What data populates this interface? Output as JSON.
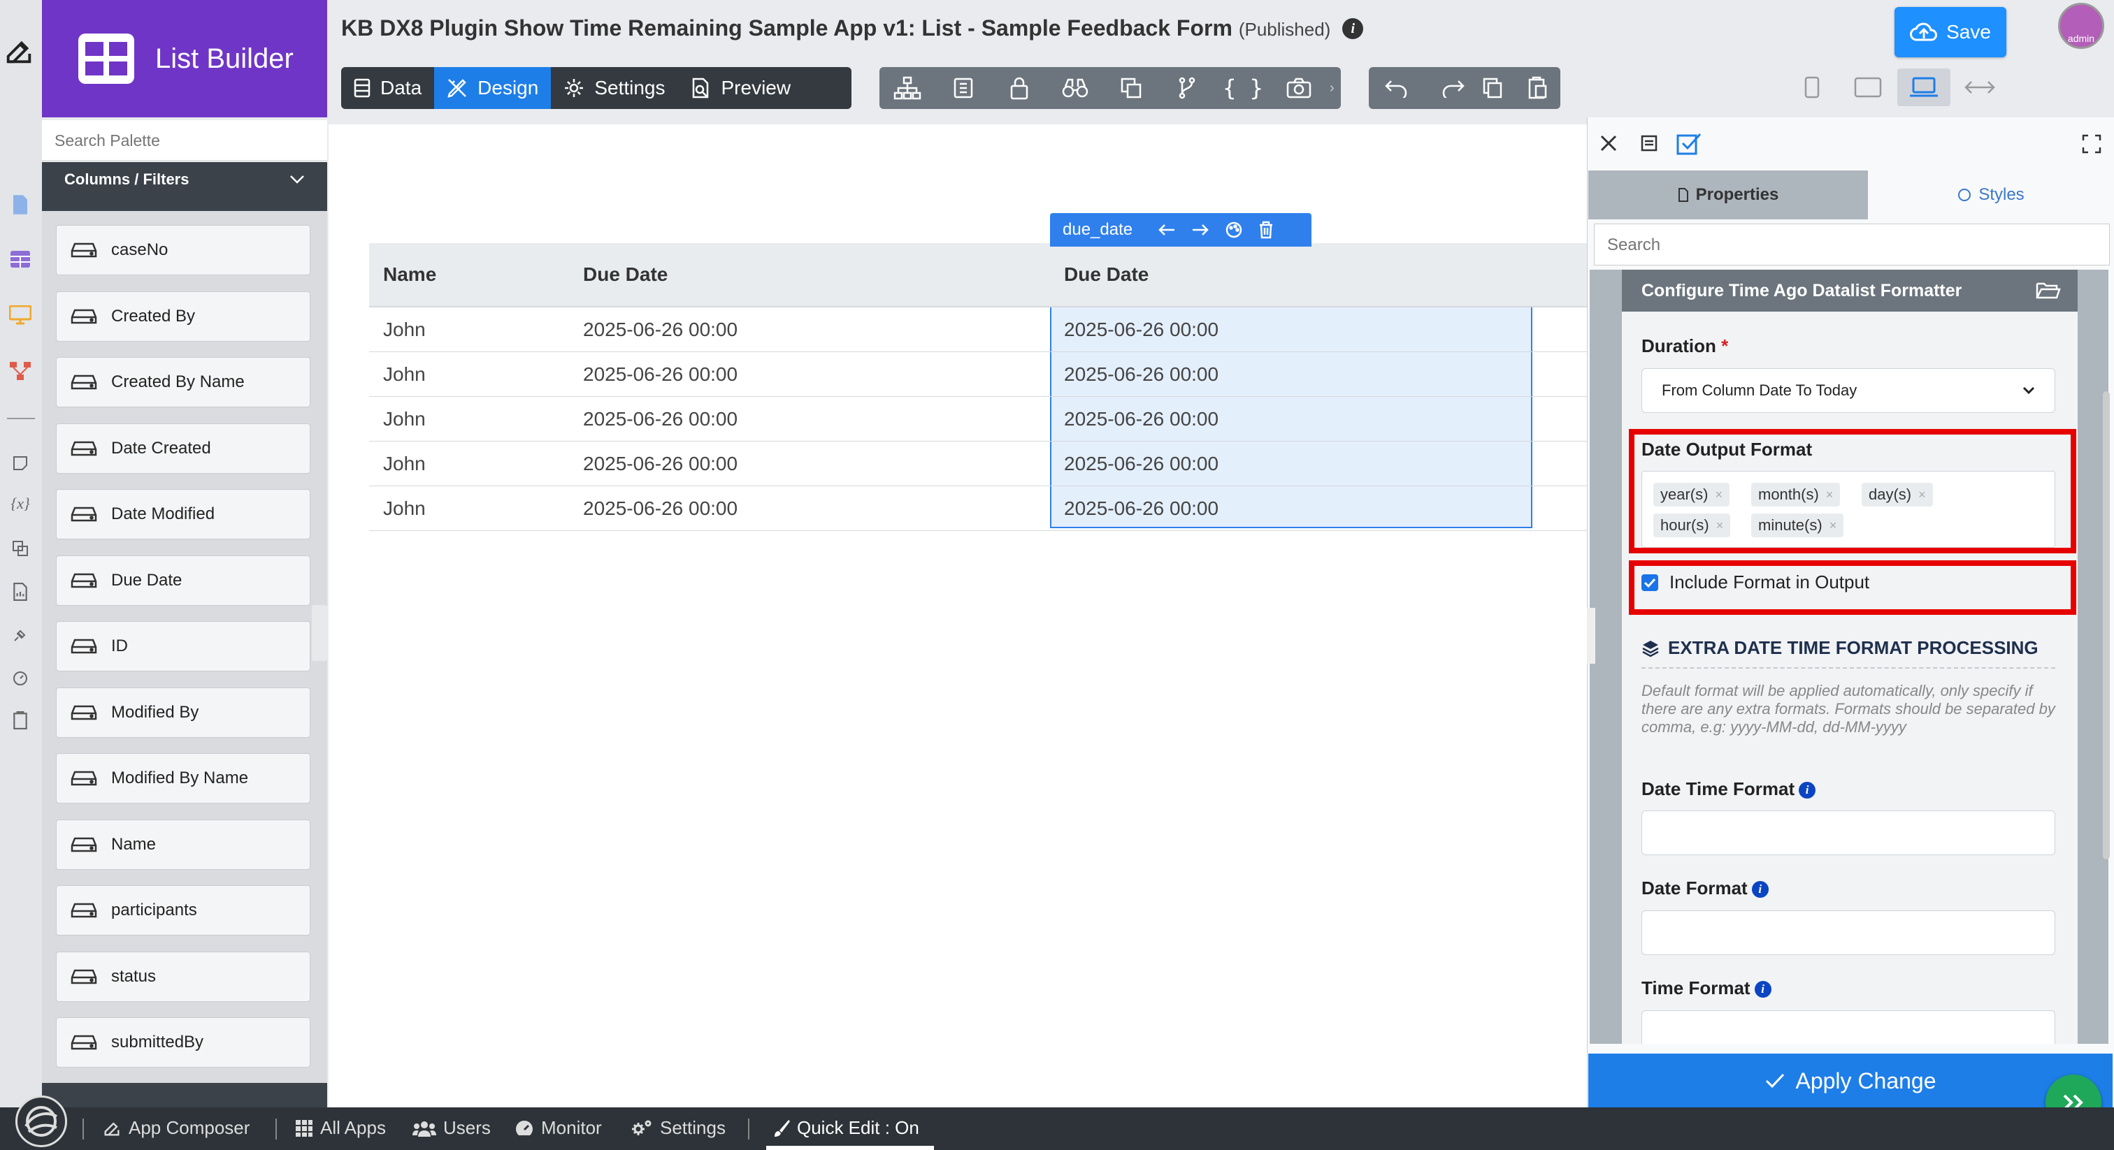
{
  "app": {
    "brand": "List Builder",
    "title": "KB DX8 Plugin Show Time Remaining Sample App v1: List - Sample Feedback Form",
    "status": "(Published)",
    "save_label": "Save",
    "avatar_text": "admin"
  },
  "mode_tabs": [
    {
      "label": "Data",
      "icon": "table-icon"
    },
    {
      "label": "Design",
      "icon": "pencil-ruler-icon",
      "active": true
    },
    {
      "label": "Settings",
      "icon": "gear-icon"
    },
    {
      "label": "Preview",
      "icon": "preview-icon"
    }
  ],
  "palette": {
    "search_placeholder": "Search Palette",
    "section": "Columns / Filters",
    "items": [
      "caseNo",
      "Created By",
      "Created By Name",
      "Date Created",
      "Date Modified",
      "Due Date",
      "ID",
      "Modified By",
      "Modified By Name",
      "Name",
      "participants",
      "status",
      "submittedBy"
    ]
  },
  "canvas": {
    "selection_label": "due_date",
    "columns": [
      "Name",
      "Due Date",
      "Due Date"
    ],
    "rows": [
      [
        "John",
        "2025-06-26 00:00",
        "2025-06-26 00:00"
      ],
      [
        "John",
        "2025-06-26 00:00",
        "2025-06-26 00:00"
      ],
      [
        "John",
        "2025-06-26 00:00",
        "2025-06-26 00:00"
      ],
      [
        "John",
        "2025-06-26 00:00",
        "2025-06-26 00:00"
      ],
      [
        "John",
        "2025-06-26 00:00",
        "2025-06-26 00:00"
      ]
    ]
  },
  "panel": {
    "tab_properties": "Properties",
    "tab_styles": "Styles",
    "search_placeholder": "Search",
    "card_title": "Configure Time Ago Datalist Formatter",
    "duration_label": "Duration",
    "required_mark": "*",
    "duration_value": "From Column Date To Today",
    "date_output_label": "Date Output Format",
    "chips": [
      "year(s)",
      "month(s)",
      "day(s)",
      "hour(s)",
      "minute(s)"
    ],
    "chip_remove": "×",
    "include_label": "Include Format in Output",
    "include_checked": true,
    "extra_heading": "EXTRA DATE TIME FORMAT PROCESSING",
    "extra_help": "Default format will be applied automatically, only specify if there are any extra formats. Formats should be separated by comma, e.g: yyyy-MM-dd, dd-MM-yyyy",
    "datetime_label": "Date Time Format",
    "date_label": "Date Format",
    "time_label": "Time Format",
    "info_glyph": "i",
    "apply_label": "Apply Change"
  },
  "bottom_bar": [
    "App Composer",
    "All Apps",
    "Users",
    "Monitor",
    "Settings",
    "Quick Edit : On"
  ],
  "colors": {
    "brand": "#6f35c6",
    "accent": "#1e7ee8",
    "highlight": "#e60000",
    "success": "#20a85a"
  }
}
